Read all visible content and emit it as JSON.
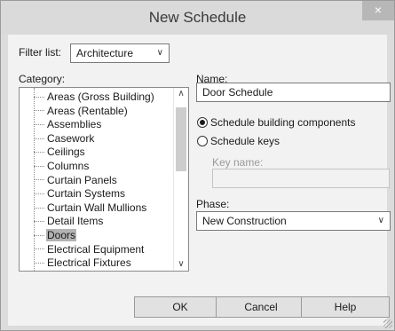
{
  "window": {
    "title": "New Schedule",
    "close_glyph": "×"
  },
  "filter": {
    "label": "Filter list:",
    "value": "Architecture"
  },
  "category": {
    "label": "Category:",
    "selected": "Doors",
    "items": [
      "Areas (Gross Building)",
      "Areas (Rentable)",
      "Assemblies",
      "Casework",
      "Ceilings",
      "Columns",
      "Curtain Panels",
      "Curtain Systems",
      "Curtain Wall Mullions",
      "Detail Items",
      "Doors",
      "Electrical Equipment",
      "Electrical Fixtures"
    ]
  },
  "name": {
    "label": "Name:",
    "value": "Door Schedule"
  },
  "schedule_type": {
    "building_components_label": "Schedule building components",
    "keys_label": "Schedule keys",
    "selected": "building_components"
  },
  "key_name": {
    "label": "Key name:",
    "value": ""
  },
  "phase": {
    "label": "Phase:",
    "value": "New Construction"
  },
  "buttons": {
    "ok": "OK",
    "cancel": "Cancel",
    "help": "Help"
  },
  "icons": {
    "dropdown_chevron": "chevron-down-icon",
    "scroll_up": "chevron-up-icon",
    "scroll_down": "chevron-down-icon",
    "close": "close-icon"
  },
  "colors": {
    "selection": "#b3b3b3",
    "titlebar": "#dadada",
    "client": "#f2f2f2"
  }
}
